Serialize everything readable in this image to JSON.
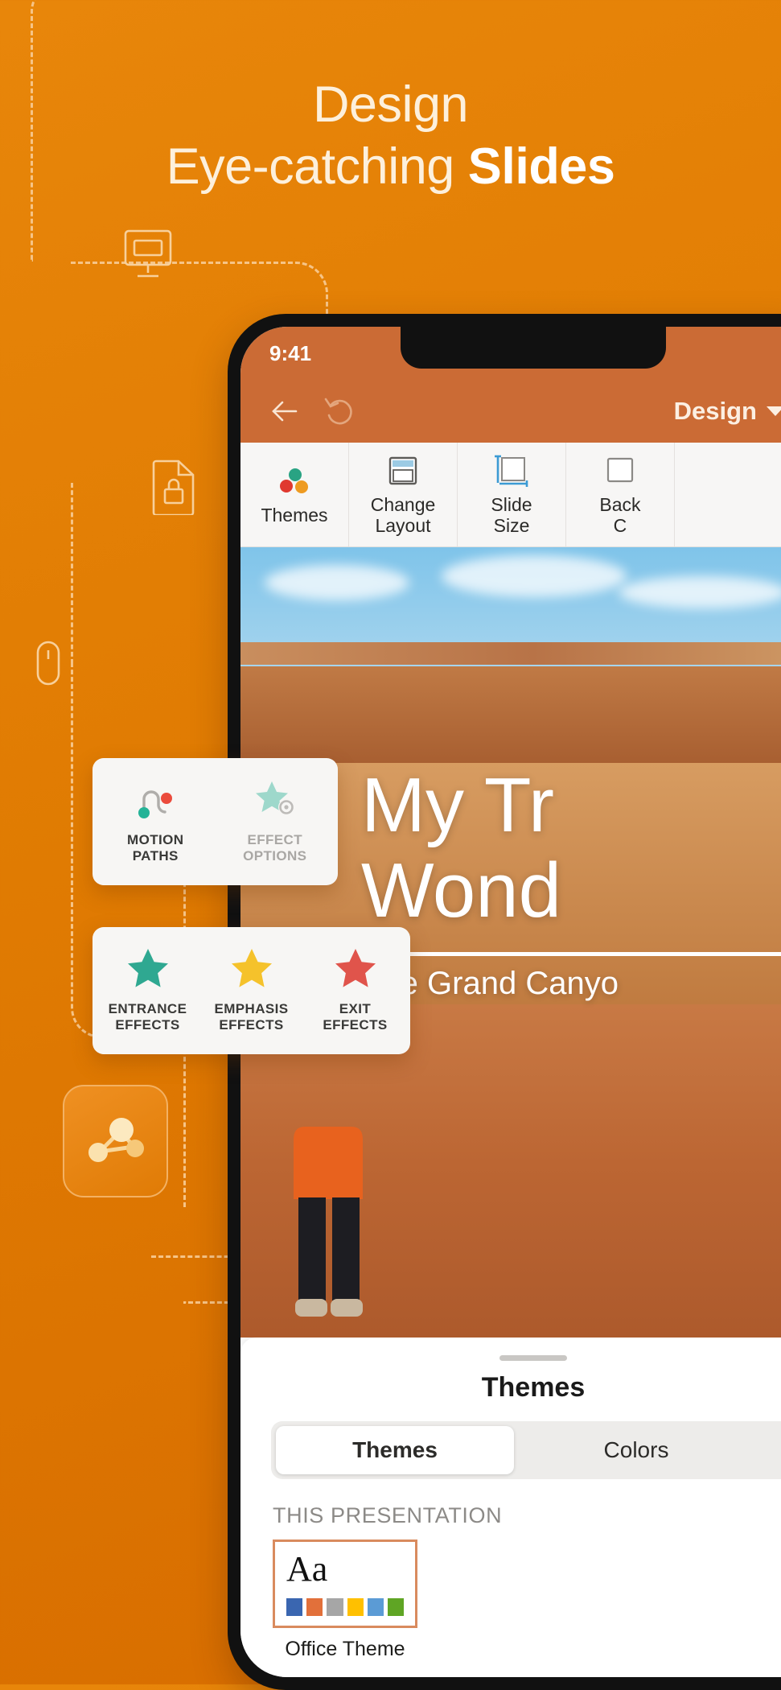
{
  "hero": {
    "line1": "Design",
    "line2_light": "Eye-catching ",
    "line2_bold": "Slides"
  },
  "decor_icons": [
    {
      "name": "presentation-screen-icon"
    },
    {
      "name": "document-lock-icon"
    },
    {
      "name": "mouse-icon"
    },
    {
      "name": "document-play-icon"
    },
    {
      "name": "app-logo-nodes-icon"
    }
  ],
  "phone": {
    "status_bar": {
      "time": "9:41"
    },
    "nav_bar": {
      "back_icon": "arrow-left-icon",
      "undo_icon": "undo-icon",
      "title": "Design",
      "caret_icon": "chevron-down-icon"
    },
    "ribbon": {
      "items": [
        {
          "label": "Themes",
          "icon": "themes-dots-icon"
        },
        {
          "label": "Change\nLayout",
          "icon": "change-layout-icon"
        },
        {
          "label": "Slide\nSize",
          "icon": "slide-size-icon"
        },
        {
          "label": "Back\nC",
          "icon": "background-color-icon"
        }
      ]
    },
    "slide": {
      "title": "My Tr",
      "title_line2": "Wond",
      "subtitle": "The Grand Canyo"
    },
    "sheet": {
      "title": "Themes",
      "tabs": [
        {
          "label": "Themes",
          "active": true
        },
        {
          "label": "Colors",
          "active": false
        },
        {
          "label": "",
          "active": false
        }
      ],
      "section_label": "THIS PRESENTATION",
      "themes": [
        {
          "sample_text": "Aa",
          "name": "Office Theme",
          "swatches": [
            "#3A66B0",
            "#E2703A",
            "#A6A6A6",
            "#FFC000",
            "#5B9BD5",
            "#5FA524"
          ]
        }
      ]
    }
  },
  "floating_cards": [
    {
      "name": "animation-card-motion",
      "cells": [
        {
          "label": "MOTION\nPATHS",
          "icon": "motion-path-icon",
          "muted": false
        },
        {
          "label": "EFFECT\nOPTIONS",
          "icon": "effect-options-icon",
          "muted": true
        }
      ]
    },
    {
      "name": "animation-card-effects",
      "cells": [
        {
          "label": "ENTRANCE\nEFFECTS",
          "icon": "star-teal-icon",
          "muted": false
        },
        {
          "label": "EMPHASIS\nEFFECTS",
          "icon": "star-yellow-icon",
          "muted": false
        },
        {
          "label": "EXIT\nEFFECTS",
          "icon": "star-red-icon",
          "muted": false
        }
      ]
    }
  ],
  "colors": {
    "background_orange": "#E07B02",
    "dashed_line": "#F6C487",
    "headline_text": "#FDF0DC",
    "ribbon_bg": "#F7F6F5",
    "nav_bar": "#CB6B35",
    "star_teal": "#2FA891",
    "star_yellow": "#F5C22B",
    "star_red": "#E0544B",
    "theme_selected_border": "#D98B5E"
  }
}
